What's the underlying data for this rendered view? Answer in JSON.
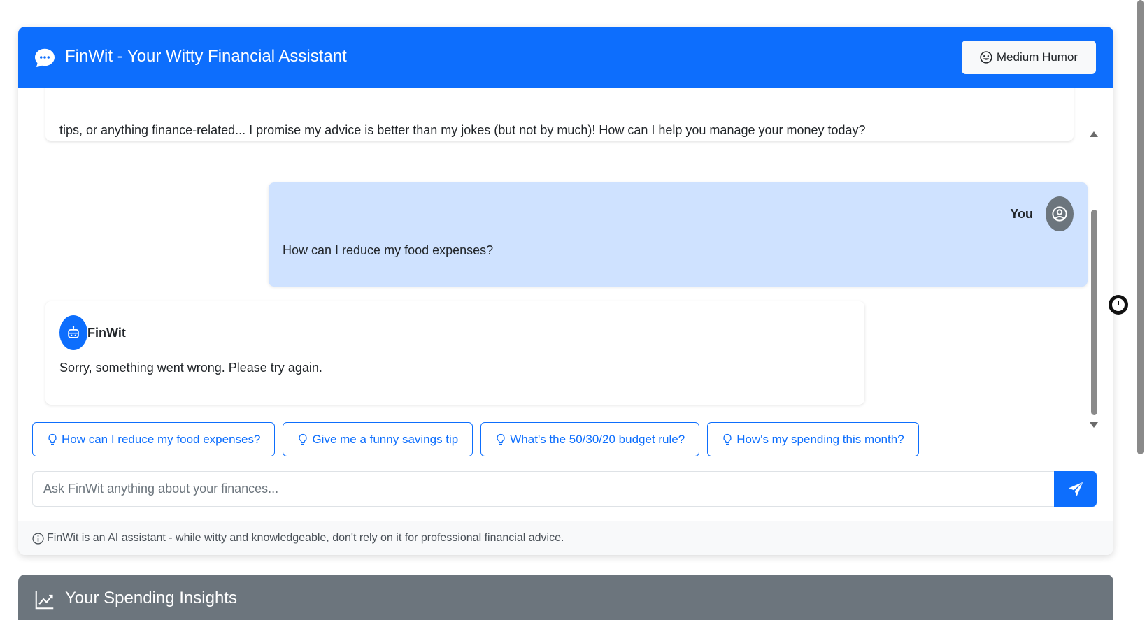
{
  "header": {
    "title": "FinWit - Your Witty Financial Assistant",
    "humor_button": "Medium Humor",
    "icon": "chat-dots-icon",
    "color": "#0d6efd"
  },
  "messages": [
    {
      "role": "assistant",
      "text": "tips, or anything finance-related... I promise my advice is better than my jokes (but not by much)! How can I help you manage your money today?"
    },
    {
      "role": "user",
      "name": "You",
      "text": "How can I reduce my food expenses?"
    },
    {
      "role": "assistant",
      "name": "FinWit",
      "text": "Sorry, something went wrong. Please try again."
    }
  ],
  "suggestions": [
    "How can I reduce my food expenses?",
    "Give me a funny savings tip",
    "What's the 50/30/20 budget rule?",
    "How's my spending this month?"
  ],
  "input": {
    "placeholder": "Ask FinWit anything about your finances..."
  },
  "footer": {
    "disclaimer": "FinWit is an AI assistant - while witty and knowledgeable, don't rely on it for professional financial advice."
  },
  "insights": {
    "title": "Your Spending Insights",
    "color": "#6c757d"
  }
}
